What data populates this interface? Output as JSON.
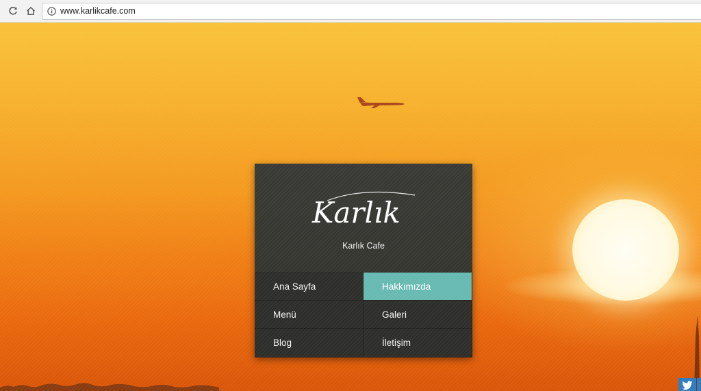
{
  "browser": {
    "url": "www.karlikcafe.com",
    "icons": [
      "reload-icon",
      "home-icon",
      "info-icon"
    ]
  },
  "card": {
    "logo_text": "Karlık",
    "site_name": "Karlık Cafe"
  },
  "nav": {
    "items": [
      {
        "label": "Ana Sayfa",
        "active": false
      },
      {
        "label": "Hakkımızda",
        "active": true
      },
      {
        "label": "Menü",
        "active": false
      },
      {
        "label": "Galeri",
        "active": false
      },
      {
        "label": "Blog",
        "active": false
      },
      {
        "label": "İletişim",
        "active": false
      }
    ]
  },
  "social": {
    "icons": [
      "twitter-icon"
    ]
  },
  "colors": {
    "accent": "#67bab1",
    "card_bg": "#393a35",
    "nav_bg": "#2d2e2a"
  }
}
